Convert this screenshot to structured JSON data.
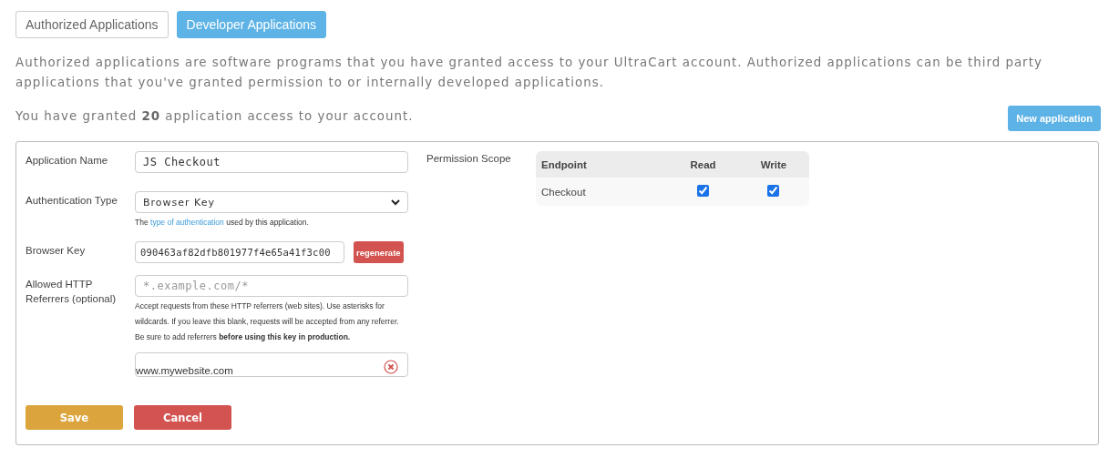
{
  "tabs": [
    {
      "label": "Authorized Applications",
      "selected": false
    },
    {
      "label": "Developer Applications",
      "selected": true
    }
  ],
  "intro": "Authorized applications are software programs that you have granted access to your UltraCart account. Authorized applications can be third party applications that you've granted permission to or internally developed applications.",
  "count_text": "You have granted **20** application access to your account.",
  "new_button": "New application",
  "form": {
    "name_label": "Application Name",
    "name_value": "JS Checkout",
    "auth_label": "Authentication Type",
    "auth_value": "Browser Key",
    "auth_help": {
      "before": "The ",
      "link": "type of authentication",
      "after": " used by this application."
    },
    "key_label": "Browser Key",
    "key_value": "090463af82dfb801977f4e65a41f3c00",
    "regenerate": "regenerate",
    "referrers_label": "Allowed HTTP Referrers (optional)",
    "referrers_placeholder": "*.example.com/*",
    "referrers_help": "Accept requests from these HTTP referrers (web sites). Use asterisks for wildcards. If you leave this blank, requests will be accepted from any referrer. Be sure to add referrers **before using this key in production.**",
    "referrers": [
      "www.mywebsite.com"
    ],
    "save": "Save",
    "cancel": "Cancel"
  },
  "permissions": {
    "label": "Permission Scope",
    "columns": [
      "Endpoint",
      "Read",
      "Write"
    ],
    "rows": [
      {
        "endpoint": "Checkout",
        "read": true,
        "write": true
      }
    ]
  }
}
